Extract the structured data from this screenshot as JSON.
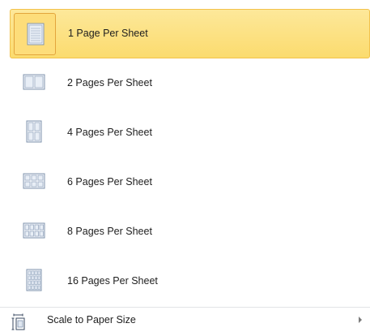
{
  "menu": {
    "items": [
      {
        "label": "1 Page Per Sheet",
        "icon": "one-page-per-sheet-icon",
        "selected": true
      },
      {
        "label": "2 Pages Per Sheet",
        "icon": "two-pages-per-sheet-icon",
        "selected": false
      },
      {
        "label": "4 Pages Per Sheet",
        "icon": "four-pages-per-sheet-icon",
        "selected": false
      },
      {
        "label": "6 Pages Per Sheet",
        "icon": "six-pages-per-sheet-icon",
        "selected": false
      },
      {
        "label": "8 Pages Per Sheet",
        "icon": "eight-pages-per-sheet-icon",
        "selected": false
      },
      {
        "label": "16 Pages Per Sheet",
        "icon": "sixteen-pages-per-sheet-icon",
        "selected": false
      }
    ],
    "scale": {
      "label": "Scale to Paper Size",
      "icon": "scale-to-paper-size-icon"
    }
  },
  "colors": {
    "highlight": "#fbdb6e",
    "highlight_border": "#f2c24c",
    "icon_frame": "#8da2bf",
    "icon_fill": "#e8eef6"
  }
}
